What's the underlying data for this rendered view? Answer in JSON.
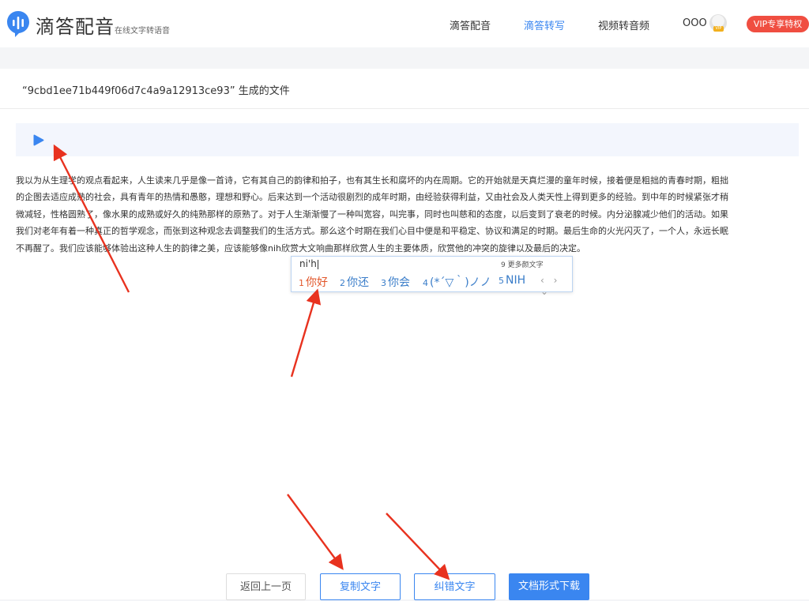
{
  "header": {
    "brand_name": "滴答配音",
    "brand_sub": "在线文字转语音",
    "nav": [
      "滴答配音",
      "滴答转写",
      "视频转音频"
    ],
    "active_nav": "滴答转写",
    "user_name": "OOO",
    "vip_label": "VIP专享特权",
    "avatar_badge": "VIP"
  },
  "file": {
    "title": "“9cbd1ee71b449f06d7c4a9a12913ce93” 生成的文件"
  },
  "player": {
    "play_icon": "play-icon"
  },
  "result": {
    "lines": [
      "我以为从生理学的观点看起来，人生读来几乎是像一首诗，它有其自己的韵律和拍子，也有其生长和腐坏的内在周期。它的开始就是天真烂漫的童年时候，接着便是粗拙的青春时期，粗拙",
      "的企图去适应成熟的社会，具有青年的热情和愚憨，理想和野心。后来达到一个活动很剧烈的成年时期，由经验获得利益，又由社会及人类天性上得到更多的经验。到中年的时候紧张才稍",
      "微减轻，性格圆熟了，像水果的成熟或好久的纯熟那样的原熟了。对于人生渐渐慢了一种叫宽容，叫完事，同时也叫慈和的态度，以后变到了衰老的时候。内分泌腺减少他们的活动。如果",
      "我们对老年有着一种真正的哲学观念，而张到这种观念去调整我们的生活方式。那么这个时期在我们心目中便是和平稳定、协议和满足的时期。最后生命的火光闪灭了，一个人，永远长眠",
      "不再醒了。我们应该能够体验出这种人生的韵律之美，应该能够像nih欣赏大文响曲那样欣赏人生的主要体质，欣赏他的冲突的旋律以及最后的决定。"
    ]
  },
  "ime": {
    "input": "ni'h",
    "more": "9 更多颜文字",
    "candidates": [
      {
        "num": "1",
        "text": "你好"
      },
      {
        "num": "2",
        "text": "你还"
      },
      {
        "num": "3",
        "text": "你会"
      },
      {
        "num": "4",
        "text": "(*´▽｀)ノノ"
      },
      {
        "num": "5",
        "text": "NIH"
      }
    ],
    "nav": "‹ › ⌄"
  },
  "actions": {
    "back": "返回上一页",
    "copy": "复制文字",
    "fix": "纠错文字",
    "download": "文档形式下载"
  },
  "colors": {
    "accent": "#3a86f0",
    "vip": "#f04e41",
    "annotation": "#e8321f",
    "ime_selected": "#e2562a"
  }
}
